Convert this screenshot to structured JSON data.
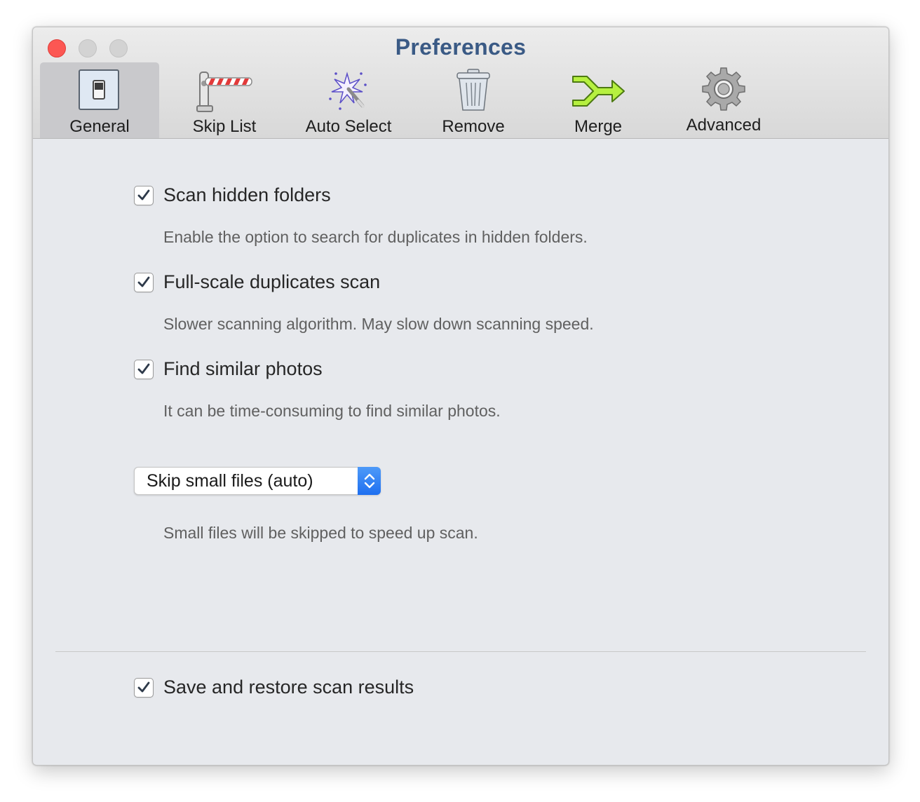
{
  "window": {
    "title": "Preferences"
  },
  "toolbar": {
    "tabs": [
      {
        "label": "General",
        "icon": "switch-icon",
        "selected": true
      },
      {
        "label": "Skip List",
        "icon": "barrier-icon",
        "selected": false
      },
      {
        "label": "Auto Select",
        "icon": "magic-wand-icon",
        "selected": false
      },
      {
        "label": "Remove",
        "icon": "trash-icon",
        "selected": false
      },
      {
        "label": "Merge",
        "icon": "merge-arrow-icon",
        "selected": false
      },
      {
        "label": "Advanced",
        "icon": "gear-icon",
        "selected": false
      }
    ]
  },
  "general": {
    "options": [
      {
        "label": "Scan hidden folders",
        "checked": true,
        "description": "Enable the option to search for duplicates in hidden folders."
      },
      {
        "label": "Full-scale duplicates scan",
        "checked": true,
        "description": "Slower scanning algorithm. May slow down scanning speed."
      },
      {
        "label": "Find similar photos",
        "checked": true,
        "description": "It can be time-consuming to find similar photos."
      }
    ],
    "skip_files": {
      "selected": "Skip small files (auto)",
      "description": "Small files will be skipped to speed up scan."
    },
    "save_restore": {
      "label": "Save and restore scan results",
      "checked": true
    }
  },
  "colors": {
    "title": "#3a5a85",
    "accent": "#1e6ff0",
    "close_button": "#fc5753",
    "window_background": "#e7e9ed"
  }
}
